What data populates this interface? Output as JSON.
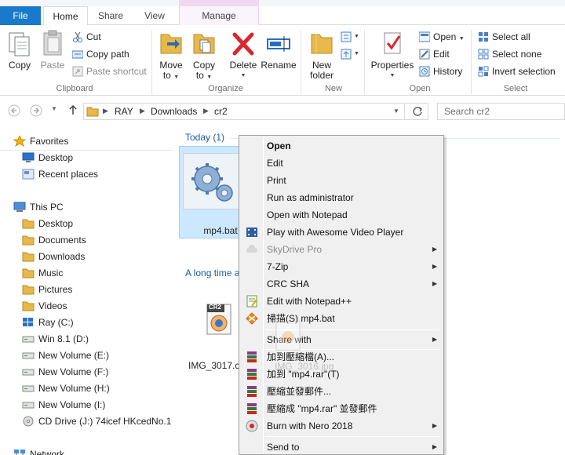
{
  "tabs": {
    "file": "File",
    "home": "Home",
    "share": "Share",
    "view": "View",
    "manage": "Manage"
  },
  "ribbon": {
    "clipboard": {
      "label": "Clipboard",
      "copy": "Copy",
      "paste": "Paste",
      "cut": "Cut",
      "copy_path": "Copy path",
      "paste_shortcut": "Paste shortcut"
    },
    "organize": {
      "label": "Organize",
      "move_to_1": "Move",
      "move_to_2": "to",
      "copy_to_1": "Copy",
      "copy_to_2": "to",
      "delete": "Delete",
      "rename": "Rename"
    },
    "new": {
      "label": "New",
      "new_folder_1": "New",
      "new_folder_2": "folder"
    },
    "open": {
      "label": "Open",
      "properties": "Properties",
      "open": "Open",
      "edit": "Edit",
      "history": "History"
    },
    "select": {
      "label": "Select",
      "select_all": "Select all",
      "select_none": "Select none",
      "invert_selection": "Invert selection"
    }
  },
  "address": {
    "crumbs": [
      "RAY",
      "Downloads",
      "cr2"
    ],
    "search_placeholder": "Search cr2"
  },
  "nav": {
    "favorites": "Favorites",
    "desktop_fav": "Desktop",
    "recent_places": "Recent places",
    "this_pc": "This PC",
    "desktop": "Desktop",
    "documents": "Documents",
    "downloads": "Downloads",
    "music": "Music",
    "pictures": "Pictures",
    "videos": "Videos",
    "ray_c": "Ray (C:)",
    "win81_d": "Win 8.1 (D:)",
    "vol_e": "New Volume (E:)",
    "vol_f": "New Volume (F:)",
    "vol_h": "New Volume (H:)",
    "vol_i": "New Volume (I:)",
    "cd_j": "CD Drive (J:) 74icef HKcedNo.1",
    "network": "Network"
  },
  "content": {
    "group_today": "Today (1)",
    "group_long_ago": "A long time ago (2)",
    "file_bat": "mp4.bat",
    "file_cr2_name": "IMG_3017.cr",
    "file_jpg_ghost": "IMG_3016.jpg",
    "cr2_badge": "CR2"
  },
  "context_menu": {
    "open": "Open",
    "edit": "Edit",
    "print": "Print",
    "run_as_admin": "Run as administrator",
    "open_notepad": "Open with Notepad",
    "play_awesome": "Play with Awesome Video Player",
    "skydrive_pro": "SkyDrive Pro",
    "seven_zip": "7-Zip",
    "crc_sha": "CRC SHA",
    "edit_npp": "Edit with Notepad++",
    "scan": "掃描(S) mp4.bat",
    "share_with": "Share with",
    "add_archive": "加到壓縮檔(A)...",
    "add_rar": "加到 \"mp4.rar\"(T)",
    "compress_email": "壓縮並發郵件...",
    "compress_rar_email": "壓縮成 \"mp4.rar\" 並發郵件",
    "burn_nero": "Burn with Nero 2018",
    "send_to": "Send to"
  },
  "colors": {
    "file_tab": "#1979ca",
    "group_header": "#1e5aa8",
    "selection": "#cce8ff"
  }
}
